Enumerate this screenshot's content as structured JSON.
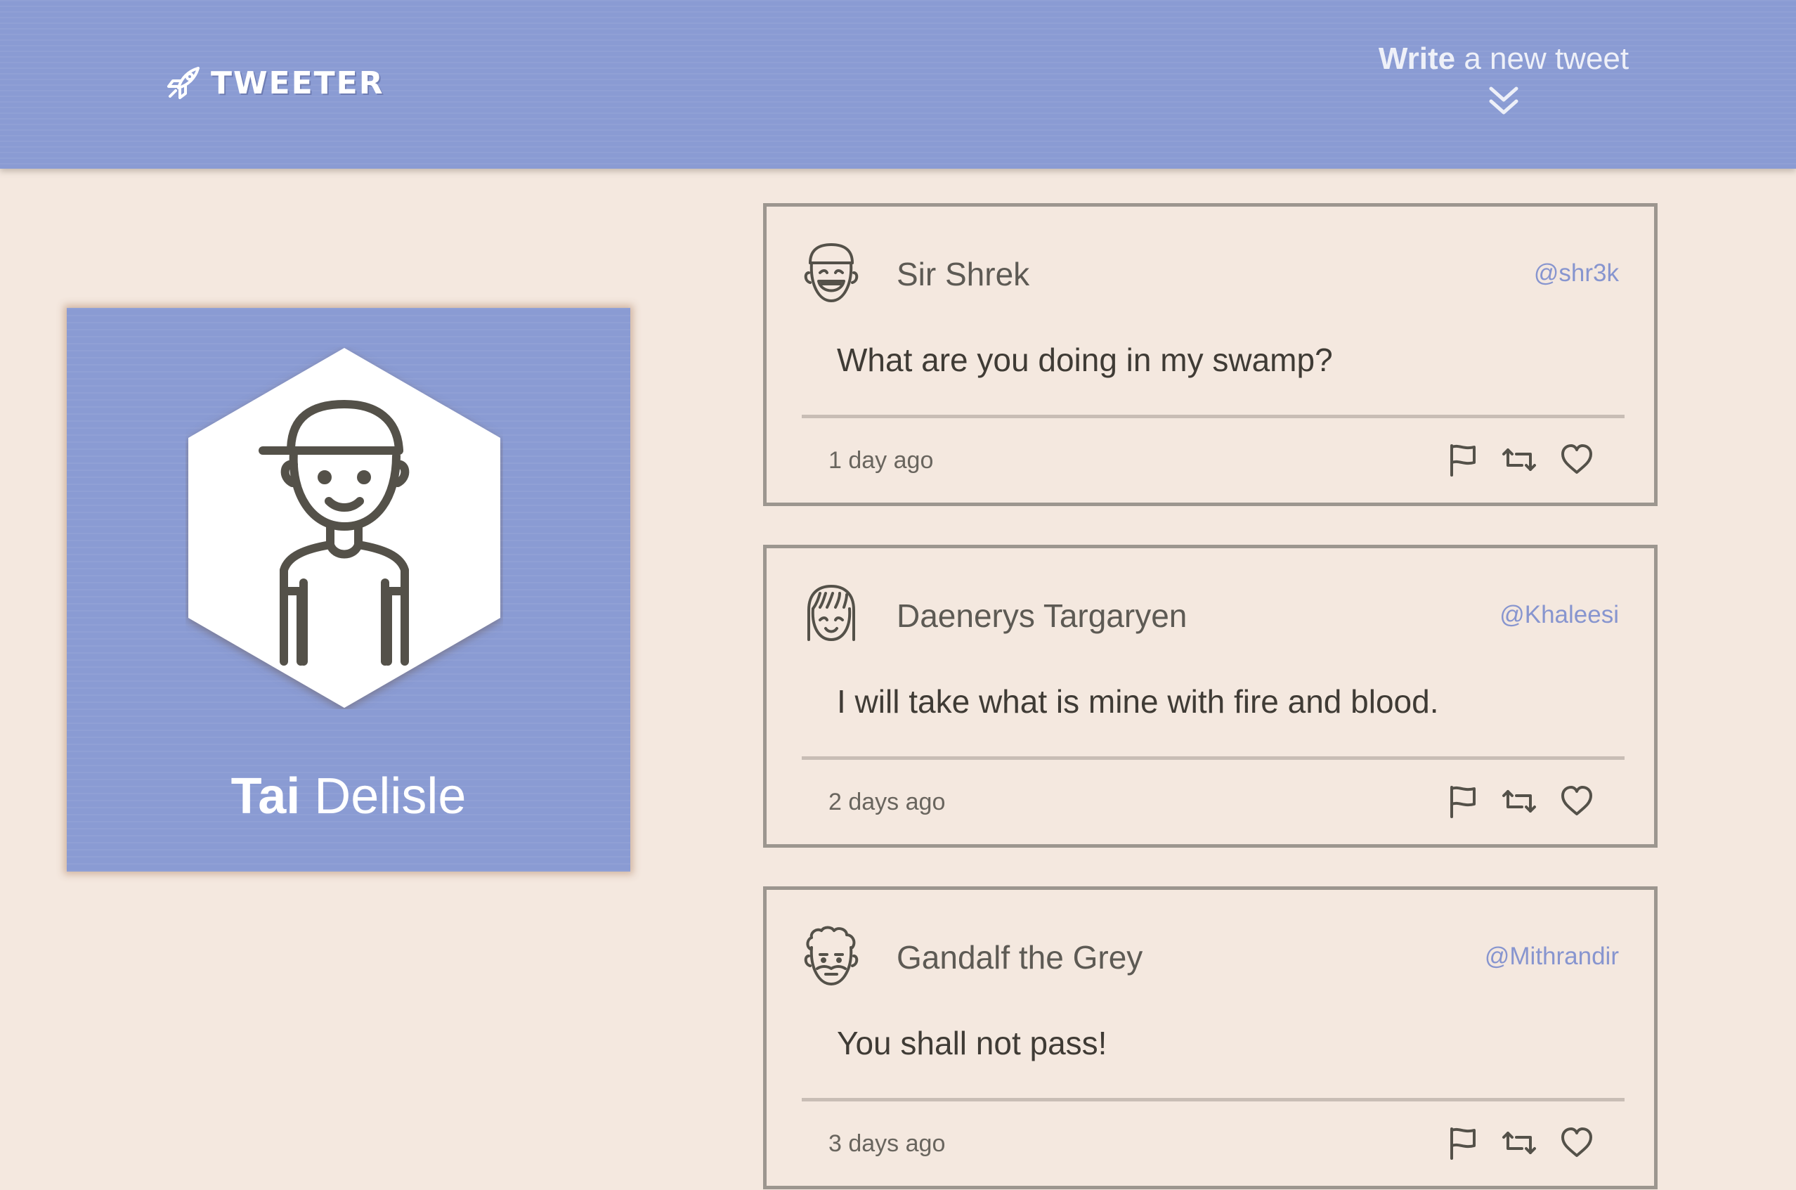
{
  "header": {
    "brand_icon": "rocket-icon",
    "brand": "TWEETER",
    "compose_bold": "Write",
    "compose_rest": " a new tweet",
    "compose_icon": "double-chevron-down-icon"
  },
  "profile": {
    "avatar_icon": "boy-with-cap-icon",
    "first_name": "Tai",
    "last_name": " Delisle"
  },
  "tweets": [
    {
      "avatar_icon": "smiling-man-icon",
      "author": "Sir Shrek",
      "handle": "@shr3k",
      "text": "What are you doing in my swamp?",
      "time": "1 day ago"
    },
    {
      "avatar_icon": "girl-with-bangs-icon",
      "author": "Daenerys Targaryen",
      "handle": "@Khaleesi",
      "text": "I will take what is mine with fire and blood.",
      "time": "2 days ago"
    },
    {
      "avatar_icon": "curly-haired-man-icon",
      "author": "Gandalf the Grey",
      "handle": "@Mithrandir",
      "text": "You shall not pass!",
      "time": "3 days ago"
    }
  ],
  "actions": {
    "flag_icon": "flag-icon",
    "retweet_icon": "retweet-icon",
    "like_icon": "heart-icon"
  },
  "colors": {
    "accent": "#8a9bd3",
    "background": "#f4e8df",
    "handle": "#8795cf",
    "border": "#9c968f"
  }
}
